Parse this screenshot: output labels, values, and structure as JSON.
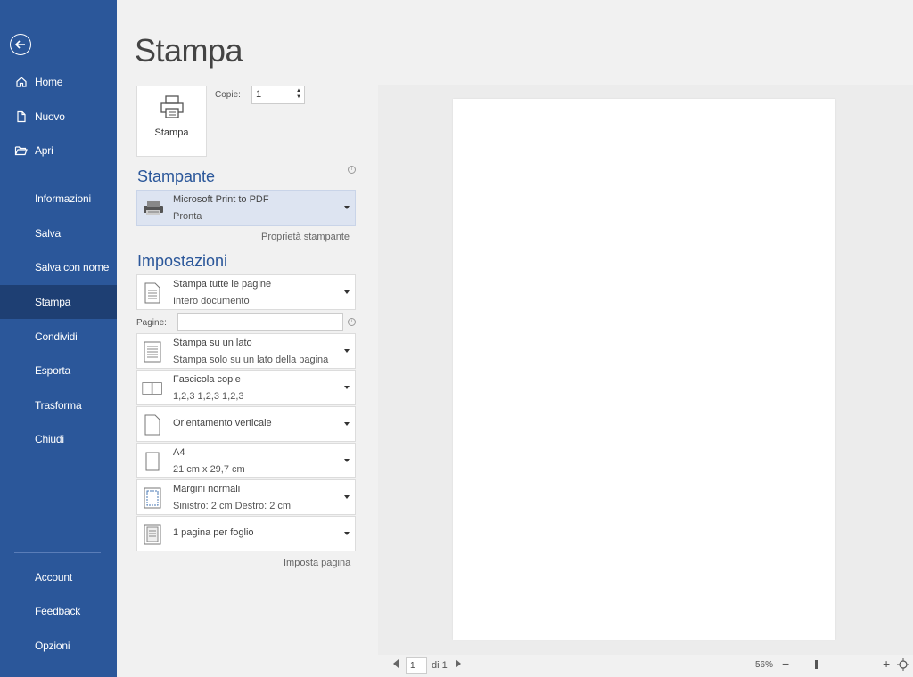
{
  "sidebar": {
    "items": [
      {
        "label": "Home"
      },
      {
        "label": "Nuovo"
      },
      {
        "label": "Apri"
      },
      {
        "label": "Informazioni"
      },
      {
        "label": "Salva"
      },
      {
        "label": "Salva con nome"
      },
      {
        "label": "Stampa"
      },
      {
        "label": "Condividi"
      },
      {
        "label": "Esporta"
      },
      {
        "label": "Trasforma"
      },
      {
        "label": "Chiudi"
      },
      {
        "label": "Account"
      },
      {
        "label": "Feedback"
      },
      {
        "label": "Opzioni"
      }
    ],
    "active": "Stampa"
  },
  "panel": {
    "title": "Stampa",
    "print_button_label": "Stampa",
    "copies_label": "Copie:",
    "copies_value": "1",
    "printer_section": "Stampante",
    "printer_name": "Microsoft Print to PDF",
    "printer_status": "Pronta",
    "printer_properties_link": "Proprietà stampante",
    "settings_section": "Impostazioni",
    "pages_label": "Pagine:",
    "page_setup_link": "Imposta pagina",
    "options": [
      {
        "line1": "Stampa tutte le pagine",
        "line2": "Intero documento"
      },
      {
        "line1": "Stampa su un lato",
        "line2": "Stampa solo su un lato della pagina"
      },
      {
        "line1": "Fascicola copie",
        "line2": "1,2,3    1,2,3    1,2,3"
      },
      {
        "line1": "Orientamento verticale",
        "line2": ""
      },
      {
        "line1": "A4",
        "line2": "21 cm x 29,7 cm"
      },
      {
        "line1": "Margini normali",
        "line2": "Sinistro:  2 cm    Destro:  2 cm"
      },
      {
        "line1": "1 pagina per foglio",
        "line2": ""
      }
    ]
  },
  "status_bar": {
    "page_value": "1",
    "page_of": "di 1",
    "zoom": "56%",
    "zoom_minus": "−",
    "zoom_plus": "+"
  }
}
